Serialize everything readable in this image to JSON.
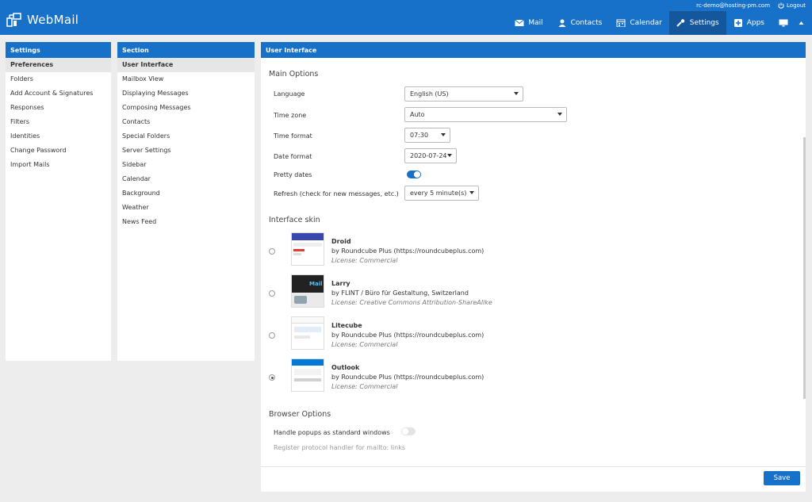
{
  "header": {
    "app_name": "WebMail",
    "user_email": "rc-demo@hosting-pm.com",
    "logout_label": "Logout",
    "nav": [
      {
        "label": "Mail",
        "icon": "envelope-icon"
      },
      {
        "label": "Contacts",
        "icon": "user-icon"
      },
      {
        "label": "Calendar",
        "icon": "calendar-icon"
      },
      {
        "label": "Settings",
        "icon": "wrench-icon",
        "active": true
      },
      {
        "label": "Apps",
        "icon": "plus-square-icon"
      }
    ]
  },
  "settings_panel": {
    "title": "Settings",
    "items": [
      "Preferences",
      "Folders",
      "Add Account & Signatures",
      "Responses",
      "Filters",
      "Identities",
      "Change Password",
      "Import Mails"
    ],
    "selected": 0
  },
  "section_panel": {
    "title": "Section",
    "items": [
      "User Interface",
      "Mailbox View",
      "Displaying Messages",
      "Composing Messages",
      "Contacts",
      "Special Folders",
      "Server Settings",
      "Sidebar",
      "Calendar",
      "Background",
      "Weather",
      "News Feed"
    ],
    "selected": 0
  },
  "content": {
    "title": "User Interface",
    "main_options_title": "Main Options",
    "language_label": "Language",
    "language_value": "English (US)",
    "timezone_label": "Time zone",
    "timezone_value": "Auto",
    "timeformat_label": "Time format",
    "timeformat_value": "07:30",
    "dateformat_label": "Date format",
    "dateformat_value": "2020-07-24",
    "prettydates_label": "Pretty dates",
    "prettydates_on": true,
    "refresh_label": "Refresh (check for new messages, etc.)",
    "refresh_value": "every 5 minute(s)",
    "skin_title": "Interface skin",
    "skins": [
      {
        "name": "Droid",
        "author": "by Roundcube Plus (https://roundcubeplus.com)",
        "license": "License: Commercial",
        "checked": false
      },
      {
        "name": "Larry",
        "author": "by FLINT / Büro für Gestaltung, Switzerland",
        "license": "License: Creative Commons Attribution-ShareAlike",
        "checked": false
      },
      {
        "name": "Litecube",
        "author": "by Roundcube Plus (https://roundcubeplus.com)",
        "license": "License: Commercial",
        "checked": false
      },
      {
        "name": "Outlook",
        "author": "by Roundcube Plus (https://roundcubeplus.com)",
        "license": "License: Commercial",
        "checked": true
      }
    ],
    "browser_title": "Browser Options",
    "popups_label": "Handle popups as standard windows",
    "popups_on": false,
    "protocol_label": "Register protocol handler for mailto: links",
    "save_label": "Save"
  },
  "colors": {
    "accent": "#1871c9",
    "accent_dark": "#15579d"
  }
}
